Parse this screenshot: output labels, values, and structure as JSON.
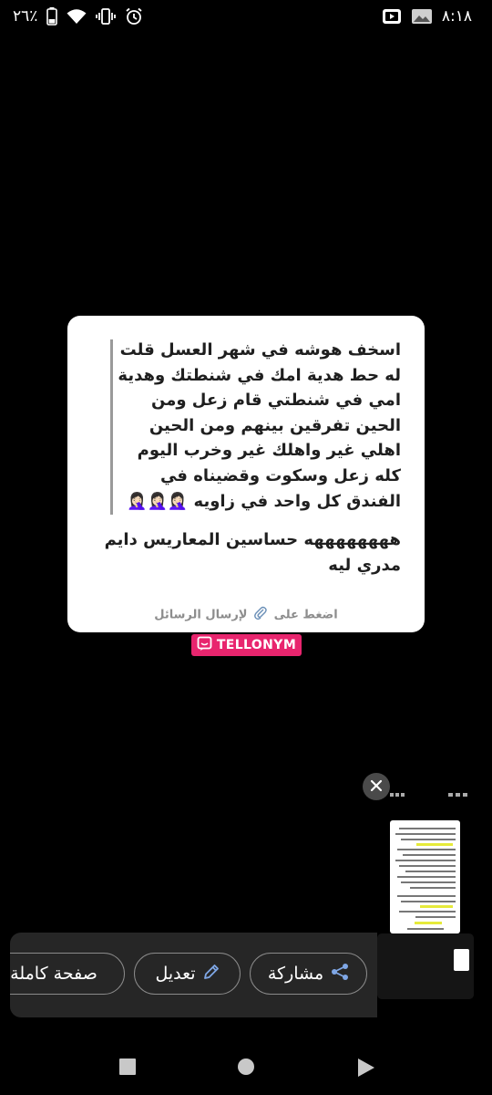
{
  "status_bar": {
    "battery": "٢٦٪",
    "time": "٨:١٨"
  },
  "card": {
    "quoted_message": "اسخف هوشه في شهر العسل قلت له حط هدية امك في شنطتك وهدية امي في شنطتي قام زعل ومن الحين تفرقين بينهم ومن الحين اهلي غير واهلك غير وخرب اليوم كله زعل وسكوت وقضيناه في الفندق كل واحد في زاويه 🤦🏻‍♀️🤦🏻‍♀️🤦🏻‍♀️",
    "reply_message": "ههههههههه حساسين المعاريس دايم مدري ليه",
    "footer_before_icon": "اضغط على",
    "footer_after_icon": "لإرسال الرسائل"
  },
  "brand": {
    "name": "TELLONYM",
    "color": "#e8256e"
  },
  "screenshot_toolbar": {
    "share_label": "مشاركة",
    "edit_label": "تعديل",
    "fullpage_label": "صفحة كاملة",
    "share_icon": "share-icon",
    "edit_icon": "pencil-icon",
    "close_icon": "close-icon"
  },
  "navigation": {
    "recents_icon": "square-icon",
    "home_icon": "circle-icon",
    "back_icon": "triangle-icon"
  }
}
